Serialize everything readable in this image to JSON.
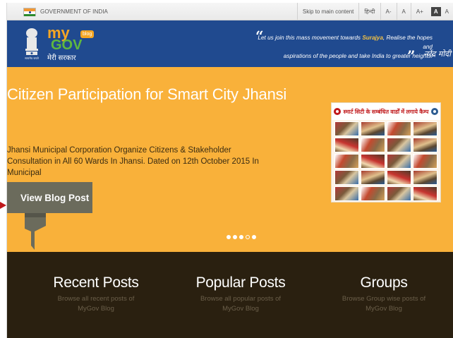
{
  "govbar": {
    "label": "GOVERNMENT OF INDIA",
    "skip": "Skip to main content",
    "hindi": "हिन्दी",
    "font_small": "A-",
    "font_normal": "A",
    "font_large": "A+",
    "contrast_dark": "A",
    "contrast_light": "A"
  },
  "header": {
    "brand_my": "my",
    "brand_gov": "GOV",
    "brand_blog": "blog",
    "brand_sub": "मेरी सरकार",
    "quote_line1_pre": "Let us join this mass movement towards ",
    "quote_highlight": "Surajya",
    "quote_line1_post": ", Realise the hopes and",
    "quote_line2": "aspirations of the people and take India to greater heights!",
    "signature": "नरेंद्र मोदी",
    "emblem_text": "सत्यमेव जयते"
  },
  "hero": {
    "title": "Citizen Participation for Smart City Jhansi",
    "description": "Jhansi Municipal Corporation Organize Citizens & Stakeholder Consultation in All 60 Wards In Jhansi. Dated on 12th October 2015 In Municipal",
    "button_label": "View Blog Post",
    "image_banner_text": "स्मार्ट सिटी के सम्बंधित वार्डों में लगाये कैम्प",
    "carousel_active_index": 3,
    "carousel_count": 5
  },
  "sections": [
    {
      "title": "Recent Posts",
      "desc_line1": "Browse all recent posts of",
      "desc_line2": "MyGov Blog"
    },
    {
      "title": "Popular Posts",
      "desc_line1": "Browse all popular posts of",
      "desc_line2": "MyGov Blog"
    },
    {
      "title": "Groups",
      "desc_line1": "Browse Group wise posts of",
      "desc_line2": "MyGov Blog"
    }
  ],
  "colors": {
    "header_blue": "#204a8f",
    "hero_orange": "#f9b13a",
    "bottom_dark": "#2a2010",
    "button_gray": "#6b6b5c",
    "accent_red": "#c0181b"
  },
  "icons": {
    "flag": "india-flag-icon",
    "emblem": "state-emblem-icon",
    "arrow": "left-pointer-icon"
  }
}
